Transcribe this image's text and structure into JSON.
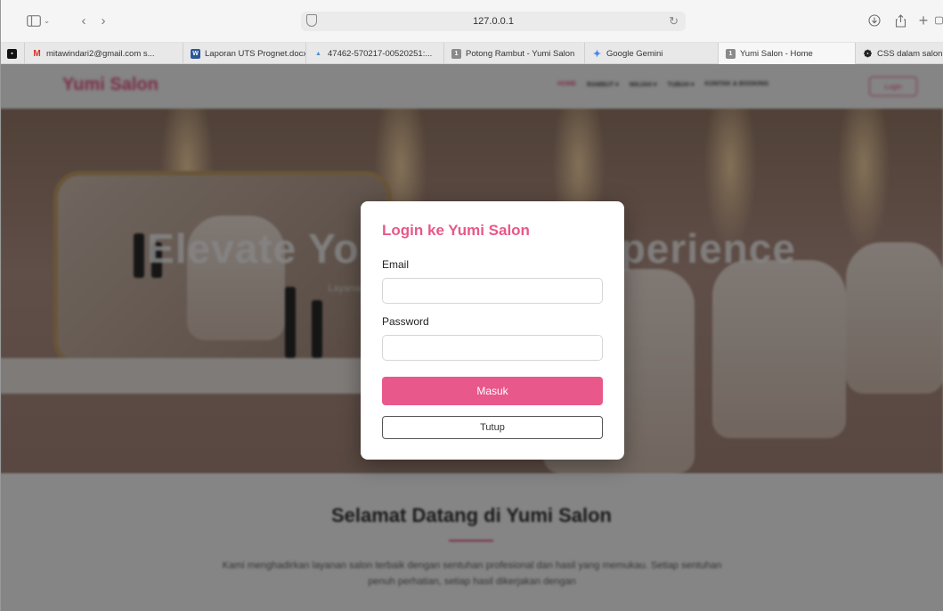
{
  "browser": {
    "url": "127.0.0.1",
    "tabs": [
      {
        "label": "",
        "icon": "app-icon",
        "color": "#111111"
      },
      {
        "label": "mitawindari2@gmail.com s...",
        "icon": "gmail-icon",
        "color": "#d93025"
      },
      {
        "label": "Laporan UTS Prognet.docx",
        "icon": "word-icon",
        "color": "#2b579a"
      },
      {
        "label": "47462-570217-00520251:...",
        "icon": "document-icon",
        "color": "#4a90d9"
      },
      {
        "label": "Potong Rambut - Yumi Salon",
        "icon": "page-icon",
        "color": "#8a8a8a"
      },
      {
        "label": "Google Gemini",
        "icon": "gemini-icon",
        "color": "#4285f4"
      },
      {
        "label": "Yumi Salon - Home",
        "icon": "page-icon",
        "color": "#8a8a8a",
        "active": true
      },
      {
        "label": "CSS dalam salon",
        "icon": "chatgpt-icon",
        "color": "#222222"
      }
    ]
  },
  "site": {
    "brand": "Yumi Salon",
    "nav": [
      "HOME",
      "RAMBUT ▾",
      "WAJAH ▾",
      "TUBUH ▾",
      "KONTAK & BOOKING"
    ],
    "login_button": "Login",
    "hero_title": "Elevate Your Beauty Experience",
    "hero_subtitle": "Layanan perawatan rambut, wajah, dan tubuh terbaik di Denpasar",
    "welcome_title": "Selamat Datang di Yumi Salon",
    "welcome_text": "Kami menghadirkan layanan salon terbaik dengan sentuhan profesional dan hasil yang memukau. Setiap sentuhan penuh perhatian, setiap hasil dikerjakan dengan"
  },
  "modal": {
    "title": "Login ke Yumi Salon",
    "email_label": "Email",
    "email_value": "",
    "password_label": "Password",
    "password_value": "",
    "submit_label": "Masuk",
    "close_label": "Tutup"
  },
  "colors": {
    "accent": "#e8588a"
  }
}
